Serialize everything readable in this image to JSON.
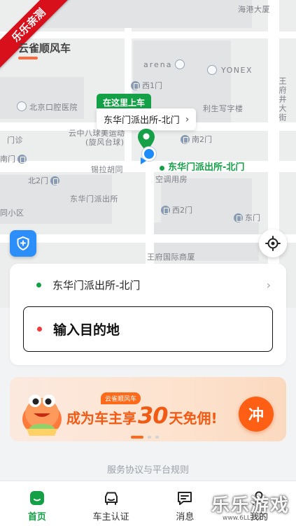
{
  "brand_ribbon": "乐乐亲测",
  "app_title": "云雀顺风车",
  "map": {
    "labels": {
      "arena": "arena",
      "yonex": "YONEX",
      "west_gate_1": "西1门",
      "hospital": "北京口腔医院",
      "gate_clinic": "门诊",
      "sports": "云中八球美运动",
      "sports2": "(旋风台球)",
      "office": "利生写字楼",
      "south_gate_2": "南2门",
      "south_gate": "南门",
      "xila": "锡拉胡同",
      "air_sub": "空调用房",
      "north_gate_2": "北2门",
      "dhm_station": "东华门派出所",
      "community": "同小区",
      "west_gate_2": "西2门",
      "east_gate": "东门",
      "wangfu_plaza": "王府国际商厦",
      "wangfujing": "王府井大街",
      "top_bldg": "海港大厦"
    }
  },
  "pickup": {
    "tag": "在这里上车",
    "name": "东华门派出所-北门",
    "chevron": "›"
  },
  "station_label": "东华门派出所-北门",
  "route": {
    "origin": "东华门派出所-北门",
    "destination_placeholder": "输入目的地"
  },
  "promo": {
    "badge": "云雀顺风车",
    "headline_pre": "成为车主享",
    "days": "30",
    "headline_post": "天免佣!",
    "cta": "冲"
  },
  "service_link": "服务协议与平台规则",
  "tabs": [
    {
      "label": "首页",
      "icon": "home-icon",
      "active": true
    },
    {
      "label": "车主认证",
      "icon": "car-icon",
      "active": false
    },
    {
      "label": "消息",
      "icon": "message-icon",
      "active": false
    },
    {
      "label": "我的",
      "icon": "person-icon",
      "active": false
    }
  ],
  "watermark": {
    "main": "乐乐游戏",
    "url": "www.6LL.com"
  },
  "colors": {
    "accent": "#14a046",
    "promo": "#f25a14",
    "location": "#1d8cf8",
    "dest_dot": "#f03c3c"
  }
}
